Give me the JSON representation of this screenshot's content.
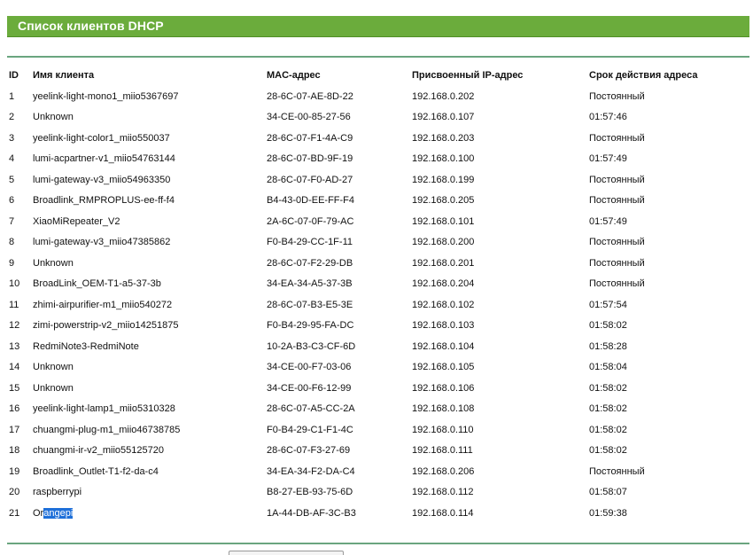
{
  "header": {
    "title": "Список клиентов DHCP"
  },
  "table": {
    "columns": {
      "id": "ID",
      "name": "Имя клиента",
      "mac": "MAC-адрес",
      "ip": "Присвоенный IP-адрес",
      "lease": "Срок действия адреса"
    },
    "rows": [
      {
        "id": "1",
        "name": "yeelink-light-mono1_miio5367697",
        "mac": "28-6C-07-AE-8D-22",
        "ip": "192.168.0.202",
        "lease": "Постоянный"
      },
      {
        "id": "2",
        "name": "Unknown",
        "mac": "34-CE-00-85-27-56",
        "ip": "192.168.0.107",
        "lease": "01:57:46"
      },
      {
        "id": "3",
        "name": "yeelink-light-color1_miio550037",
        "mac": "28-6C-07-F1-4A-C9",
        "ip": "192.168.0.203",
        "lease": "Постоянный"
      },
      {
        "id": "4",
        "name": "lumi-acpartner-v1_miio54763144",
        "mac": "28-6C-07-BD-9F-19",
        "ip": "192.168.0.100",
        "lease": "01:57:49"
      },
      {
        "id": "5",
        "name": "lumi-gateway-v3_miio54963350",
        "mac": "28-6C-07-F0-AD-27",
        "ip": "192.168.0.199",
        "lease": "Постоянный"
      },
      {
        "id": "6",
        "name": "Broadlink_RMPROPLUS-ee-ff-f4",
        "mac": "B4-43-0D-EE-FF-F4",
        "ip": "192.168.0.205",
        "lease": "Постоянный"
      },
      {
        "id": "7",
        "name": "XiaoMiRepeater_V2",
        "mac": "2A-6C-07-0F-79-AC",
        "ip": "192.168.0.101",
        "lease": "01:57:49"
      },
      {
        "id": "8",
        "name": "lumi-gateway-v3_miio47385862",
        "mac": "F0-B4-29-CC-1F-11",
        "ip": "192.168.0.200",
        "lease": "Постоянный"
      },
      {
        "id": "9",
        "name": "Unknown",
        "mac": "28-6C-07-F2-29-DB",
        "ip": "192.168.0.201",
        "lease": "Постоянный"
      },
      {
        "id": "10",
        "name": "BroadLink_OEM-T1-a5-37-3b",
        "mac": "34-EA-34-A5-37-3B",
        "ip": "192.168.0.204",
        "lease": "Постоянный"
      },
      {
        "id": "11",
        "name": "zhimi-airpurifier-m1_miio540272",
        "mac": "28-6C-07-B3-E5-3E",
        "ip": "192.168.0.102",
        "lease": "01:57:54"
      },
      {
        "id": "12",
        "name": "zimi-powerstrip-v2_miio14251875",
        "mac": "F0-B4-29-95-FA-DC",
        "ip": "192.168.0.103",
        "lease": "01:58:02"
      },
      {
        "id": "13",
        "name": "RedmiNote3-RedmiNote",
        "mac": "10-2A-B3-C3-CF-6D",
        "ip": "192.168.0.104",
        "lease": "01:58:28"
      },
      {
        "id": "14",
        "name": "Unknown",
        "mac": "34-CE-00-F7-03-06",
        "ip": "192.168.0.105",
        "lease": "01:58:04"
      },
      {
        "id": "15",
        "name": "Unknown",
        "mac": "34-CE-00-F6-12-99",
        "ip": "192.168.0.106",
        "lease": "01:58:02"
      },
      {
        "id": "16",
        "name": "yeelink-light-lamp1_miio5310328",
        "mac": "28-6C-07-A5-CC-2A",
        "ip": "192.168.0.108",
        "lease": "01:58:02"
      },
      {
        "id": "17",
        "name": "chuangmi-plug-m1_miio46738785",
        "mac": "F0-B4-29-C1-F1-4C",
        "ip": "192.168.0.110",
        "lease": "01:58:02"
      },
      {
        "id": "18",
        "name": "chuangmi-ir-v2_miio55125720",
        "mac": "28-6C-07-F3-27-69",
        "ip": "192.168.0.111",
        "lease": "01:58:02"
      },
      {
        "id": "19",
        "name": "Broadlink_Outlet-T1-f2-da-c4",
        "mac": "34-EA-34-F2-DA-C4",
        "ip": "192.168.0.206",
        "lease": "Постоянный"
      },
      {
        "id": "20",
        "name": "raspberrypi",
        "mac": "B8-27-EB-93-75-6D",
        "ip": "192.168.0.112",
        "lease": "01:58:07"
      },
      {
        "id": "21",
        "name_prefix": "Or",
        "name_selected": "angepi",
        "mac": "1A-44-DB-AF-3C-B3",
        "ip": "192.168.0.114",
        "lease": "01:59:38"
      }
    ]
  },
  "colors": {
    "title_bar": "#6bac3c",
    "rule": "#6aa57f",
    "selection": "#1e6fd9"
  }
}
